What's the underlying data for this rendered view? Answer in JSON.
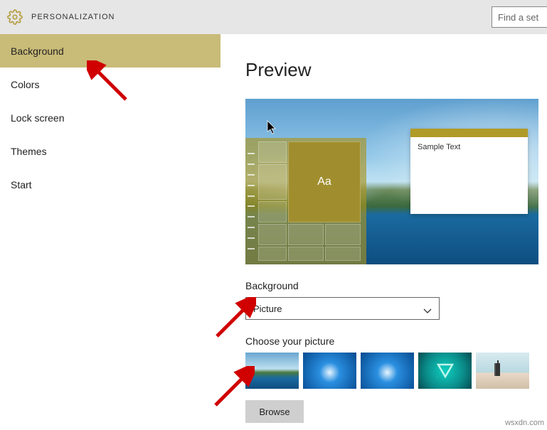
{
  "header": {
    "title": "PERSONALIZATION",
    "search_placeholder": "Find a set"
  },
  "sidebar": {
    "items": [
      {
        "label": "Background",
        "active": true
      },
      {
        "label": "Colors",
        "active": false
      },
      {
        "label": "Lock screen",
        "active": false
      },
      {
        "label": "Themes",
        "active": false
      },
      {
        "label": "Start",
        "active": false
      }
    ]
  },
  "content": {
    "preview_heading": "Preview",
    "preview_tile_text": "Aa",
    "preview_window_text": "Sample Text",
    "background_label": "Background",
    "background_dropdown_value": "Picture",
    "choose_picture_label": "Choose your picture",
    "browse_button": "Browse"
  },
  "watermark": "wsxdn.com"
}
